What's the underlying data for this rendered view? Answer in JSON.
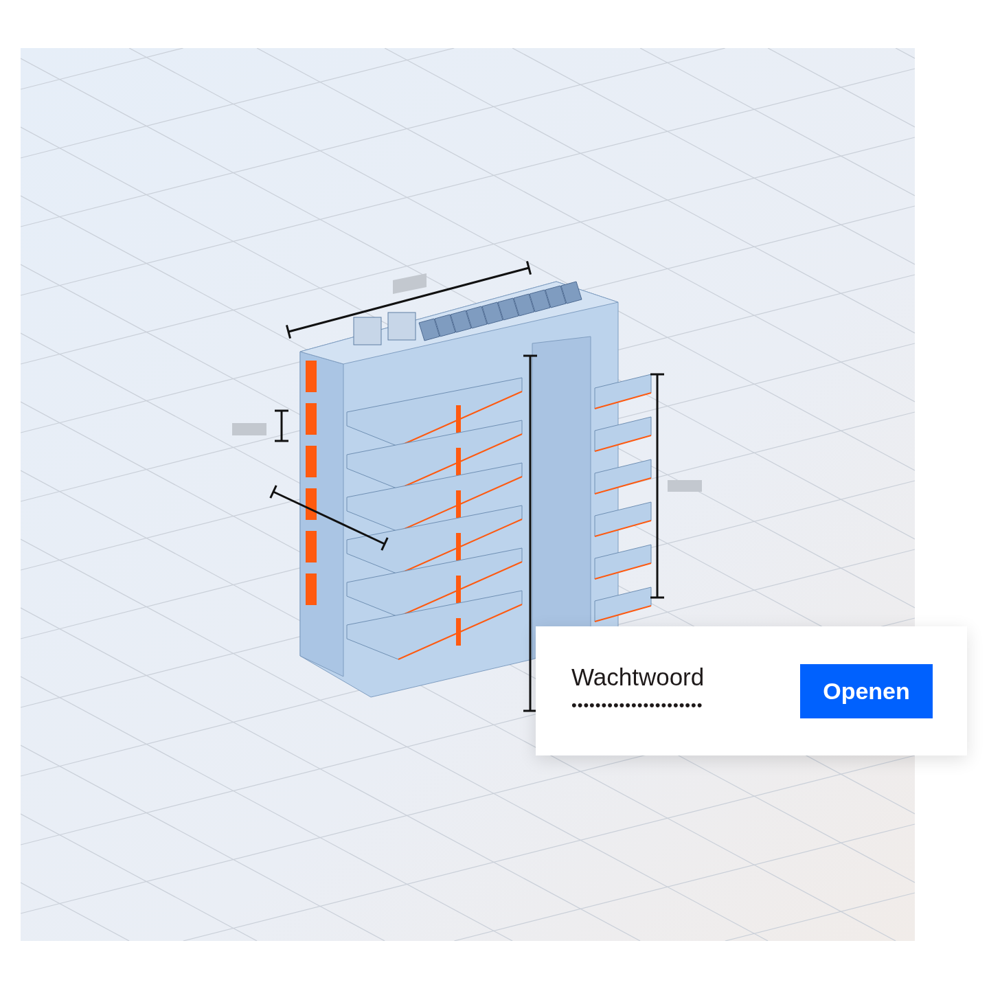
{
  "password_dialog": {
    "label": "Wachtwoord",
    "value": "••••••••••••••••••••••",
    "button": "Openen"
  }
}
